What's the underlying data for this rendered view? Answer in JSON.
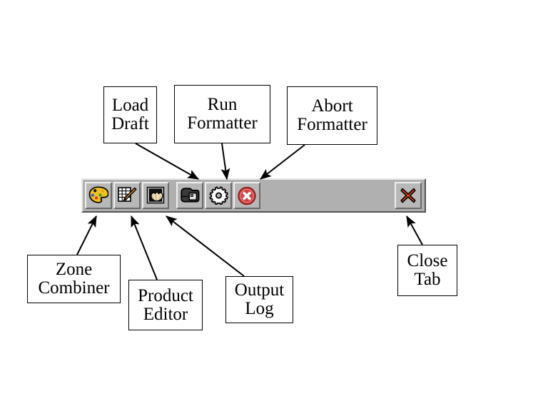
{
  "toolbar": {
    "name": "application-toolbar",
    "background_color": "#b0b0b0",
    "buttons": [
      {
        "id": "zone-combiner",
        "icon": "palette-icon",
        "label": "Zone Combiner"
      },
      {
        "id": "product-editor",
        "icon": "notepad-pencil-icon",
        "label": "Product Editor"
      },
      {
        "id": "output-log",
        "icon": "shell-picture-icon",
        "label": "Output Log"
      },
      {
        "id": "load-draft",
        "icon": "folder-box-icon",
        "label": "Load Draft"
      },
      {
        "id": "run-formatter",
        "icon": "gear-icon",
        "label": "Run Formatter"
      },
      {
        "id": "abort-formatter",
        "icon": "red-circle-x-icon",
        "label": "Abort Formatter"
      }
    ],
    "close_tab": {
      "id": "close-tab",
      "icon": "red-x-icon",
      "label": "Close Tab"
    }
  },
  "callouts": {
    "load_draft": {
      "line1": "Load",
      "line2": "Draft"
    },
    "run_formatter": {
      "line1": "Run",
      "line2": "Formatter"
    },
    "abort_formatter": {
      "line1": "Abort",
      "line2": "Formatter"
    },
    "zone_combiner": {
      "line1": "Zone",
      "line2": "Combiner"
    },
    "product_editor": {
      "line1": "Product",
      "line2": "Editor"
    },
    "output_log": {
      "line1": "Output",
      "line2": "Log"
    },
    "close_tab": {
      "line1": "Close",
      "line2": "Tab"
    }
  },
  "colors": {
    "palette_body": "#f2c21c",
    "pencil": "#e8913c",
    "shell": "#f0e0b8",
    "abort_red": "#d03a3a",
    "close_red": "#e8441c",
    "toolbar_face": "#b0b0b0",
    "button_face": "#b8b8b8",
    "outline": "#000000"
  }
}
